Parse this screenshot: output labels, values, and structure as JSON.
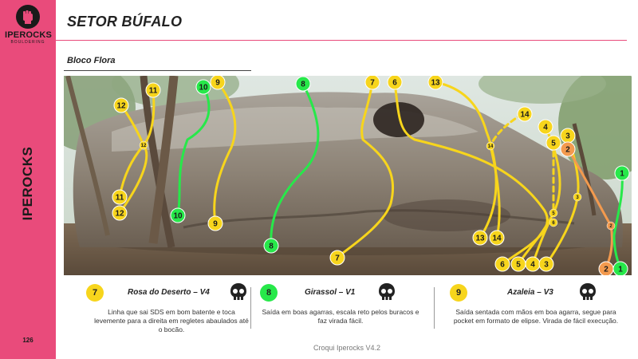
{
  "brand": {
    "logo_name": "IPEROCKS",
    "logo_sub": "BOULDERING",
    "vertical": "IPEROCKS",
    "page_number": "126"
  },
  "header": {
    "title": "SETOR BÚFALO",
    "subtitle": "Bloco Flora"
  },
  "colors": {
    "sidebar": "#e94b7b",
    "yellow": "#f7d51c",
    "green": "#27e84a",
    "orange": "#f39a4e"
  },
  "markers": [
    {
      "label": "8",
      "color": "green"
    },
    {
      "label": "8",
      "color": "green"
    },
    {
      "label": "10",
      "color": "green"
    },
    {
      "label": "10",
      "color": "green"
    },
    {
      "label": "9",
      "color": "yellow"
    },
    {
      "label": "9",
      "color": "yellow"
    },
    {
      "label": "11",
      "color": "yellow"
    },
    {
      "label": "11",
      "color": "yellow"
    },
    {
      "label": "12",
      "color": "yellow"
    },
    {
      "label": "12",
      "color": "yellow"
    },
    {
      "label": "7",
      "color": "yellow"
    },
    {
      "label": "7",
      "color": "yellow"
    },
    {
      "label": "6",
      "color": "yellow"
    },
    {
      "label": "6",
      "color": "yellow"
    },
    {
      "label": "13",
      "color": "yellow"
    },
    {
      "label": "13",
      "color": "yellow"
    },
    {
      "label": "14",
      "color": "yellow"
    },
    {
      "label": "14",
      "color": "yellow"
    },
    {
      "label": "4",
      "color": "yellow"
    },
    {
      "label": "4",
      "color": "yellow"
    },
    {
      "label": "5",
      "color": "yellow"
    },
    {
      "label": "5",
      "color": "yellow"
    },
    {
      "label": "3",
      "color": "yellow"
    },
    {
      "label": "3",
      "color": "yellow"
    },
    {
      "label": "2",
      "color": "orange"
    },
    {
      "label": "2",
      "color": "orange"
    },
    {
      "label": "1",
      "color": "green"
    },
    {
      "label": "1",
      "color": "green"
    },
    {
      "label": "12",
      "color": "yellow"
    },
    {
      "label": "11",
      "color": "yellow"
    },
    {
      "label": "14",
      "color": "yellow"
    },
    {
      "label": "5",
      "color": "yellow"
    },
    {
      "label": "6",
      "color": "yellow"
    },
    {
      "label": "3",
      "color": "yellow"
    },
    {
      "label": "2",
      "color": "orange"
    }
  ],
  "routes": [
    {
      "number": "7",
      "name": "Rosa do Deserto – V4",
      "color": "yellow",
      "icon": "skull-icon",
      "description": "Linha que sai SDS em bom batente e toca levemente para a direita em regletes abaulados até o bocão."
    },
    {
      "number": "8",
      "name": "Girassol – V1",
      "color": "green",
      "icon": "skull-icon",
      "description": "Saída em boas agarras, escala reto pelos buracos e faz virada fácil."
    },
    {
      "number": "9",
      "name": "Azaleia – V3",
      "color": "yellow",
      "icon": "skull-icon",
      "description": "Saída sentada com mãos em boa agarra, segue para pocket em formato de elipse. Virada de fácil execução."
    }
  ],
  "footer": "Croqui Iperocks V4.2"
}
